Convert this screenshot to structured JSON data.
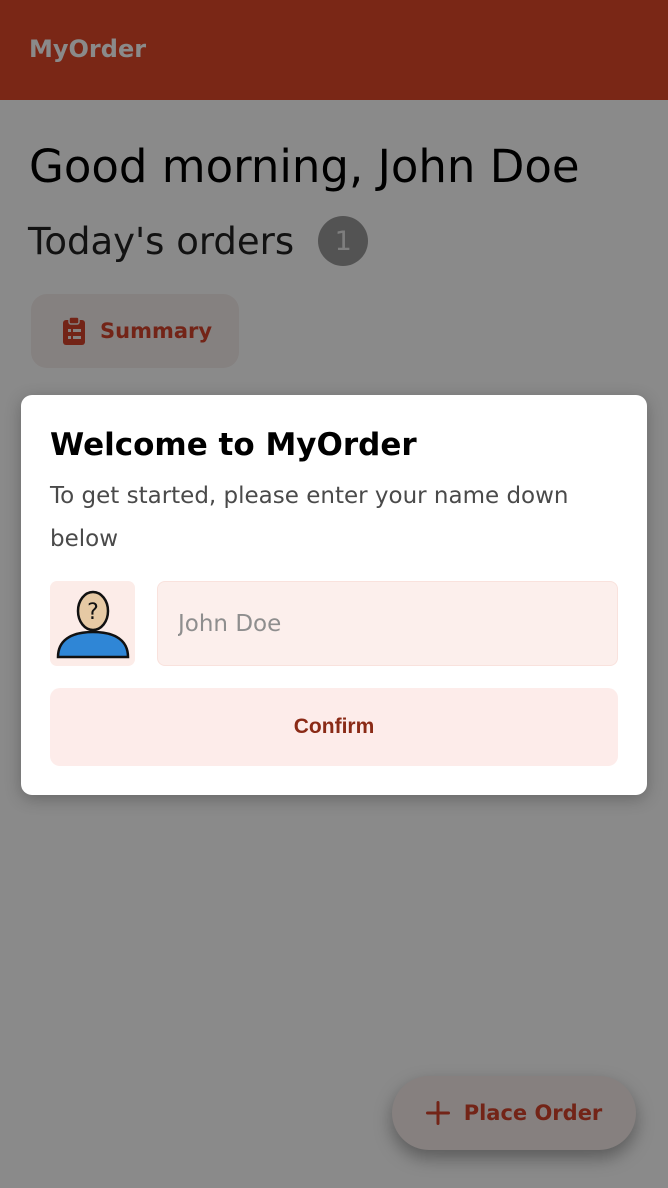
{
  "colors": {
    "primary": "#e2482a",
    "accent_text": "#d4432b",
    "confirm_text": "#8a2a16"
  },
  "app_bar": {
    "title": "MyOrder"
  },
  "home": {
    "greeting": "Good morning, John Doe",
    "orders_label": "Today's orders",
    "orders_count": "1",
    "summary_button": {
      "label": "Summary",
      "icon": "clipboard-list-icon"
    },
    "fab": {
      "label": "Place Order",
      "icon": "plus-icon"
    }
  },
  "dialog": {
    "title": "Welcome to MyOrder",
    "subtitle": "To get started, please enter your name down below",
    "avatar_icon": "unknown-person-icon",
    "name_input": {
      "placeholder": "John Doe",
      "value": ""
    },
    "confirm_label": "Confirm"
  }
}
